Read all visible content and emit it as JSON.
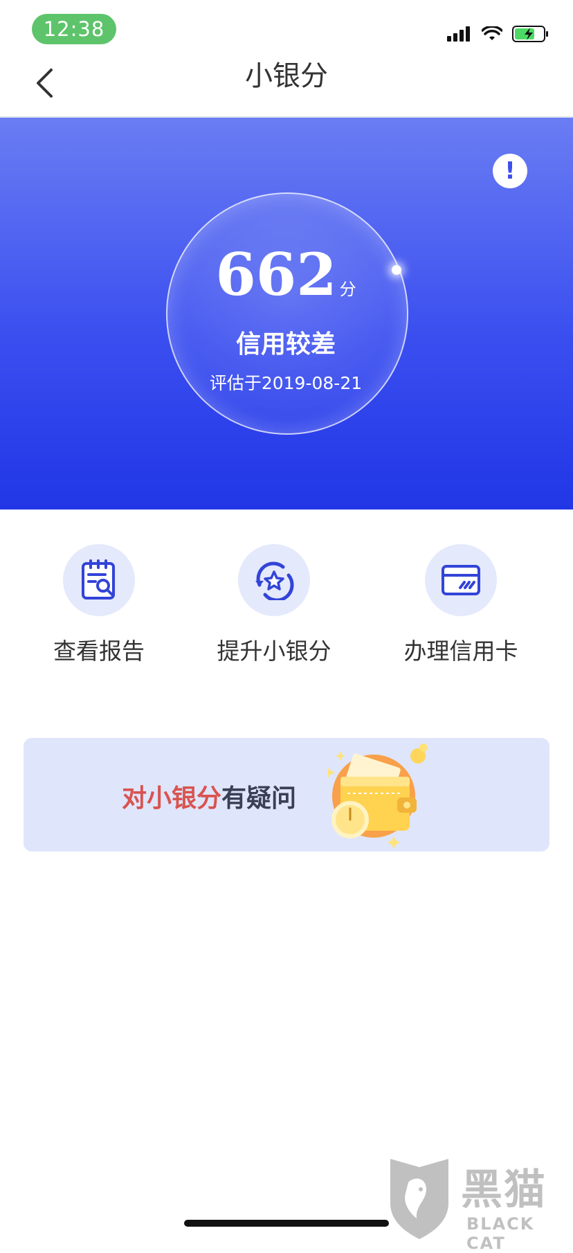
{
  "status_bar": {
    "time": "12:38"
  },
  "nav": {
    "title": "小银分"
  },
  "hero": {
    "score": "662",
    "score_unit": "分",
    "level": "信用较差",
    "evaluated_date": "评估于2019-08-21"
  },
  "actions": [
    {
      "label": "查看报告",
      "icon": "report-search-icon"
    },
    {
      "label": "提升小银分",
      "icon": "star-refresh-icon"
    },
    {
      "label": "办理信用卡",
      "icon": "credit-card-icon"
    }
  ],
  "faq": {
    "highlight": "对小银分",
    "rest": "有疑问"
  },
  "watermark": {
    "cn": "黑猫",
    "en": "BLACK CAT"
  },
  "colors": {
    "accent": "#3b4ff0",
    "status_green": "#5ec46b",
    "faq_red": "#d9534f",
    "icon_bg": "#e4e9fb"
  }
}
